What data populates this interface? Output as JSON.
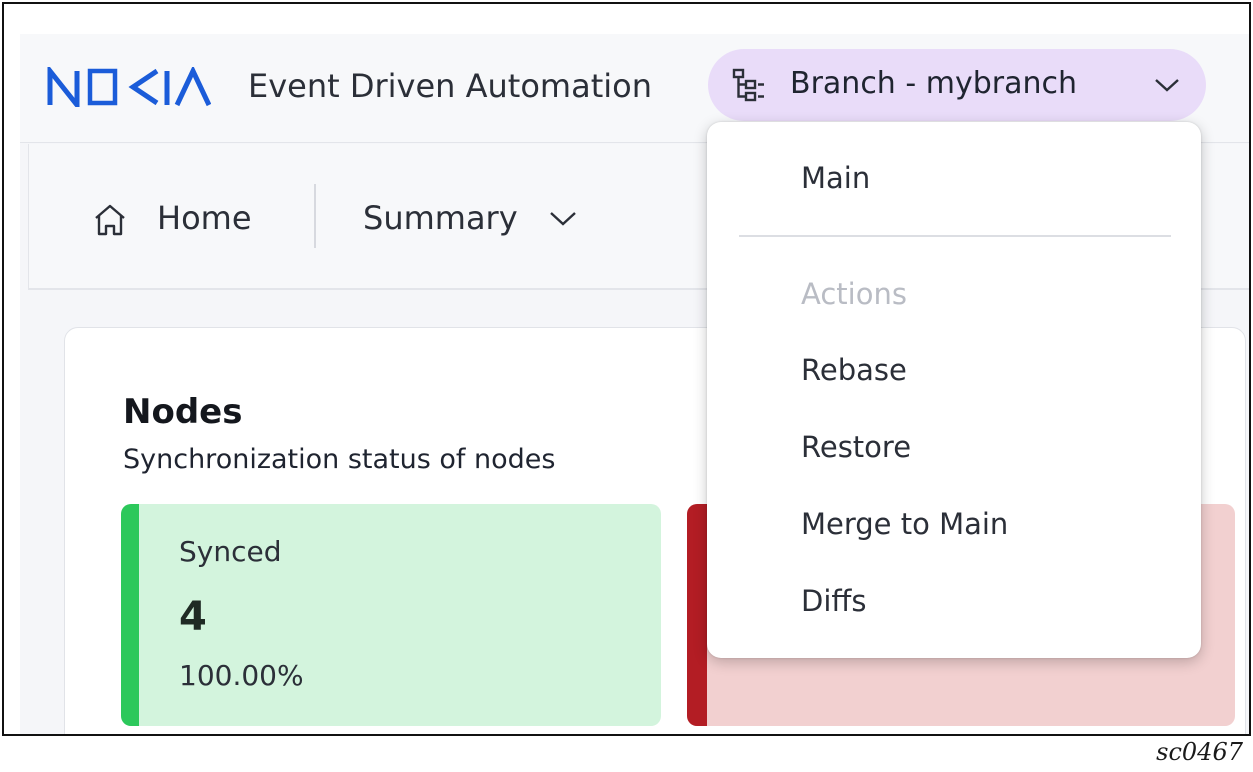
{
  "header": {
    "brand": "NOKIA",
    "app_title": "Event Driven Automation",
    "branch_selector": {
      "label": "Branch - mybranch",
      "icon": "branch-icon",
      "chevron": "chevron-down-icon"
    }
  },
  "nav": {
    "home_label": "Home",
    "summary_label": "Summary"
  },
  "branch_menu": {
    "main_label": "Main",
    "section_label": "Actions",
    "actions": [
      "Rebase",
      "Restore",
      "Merge to Main",
      "Diffs"
    ]
  },
  "nodes_card": {
    "title": "Nodes",
    "subtitle": "Synchronization status of nodes",
    "synced": {
      "label": "Synced",
      "value": "4",
      "percent": "100.00%"
    }
  },
  "colors": {
    "brand_blue": "#124191",
    "branch_pill": "#e9dcf9",
    "synced_bg": "#d3f4dd",
    "synced_accent": "#2cc85b",
    "unsynced_bg": "#f2d0d0",
    "unsynced_accent": "#b31d24"
  },
  "caption": "sc0467"
}
